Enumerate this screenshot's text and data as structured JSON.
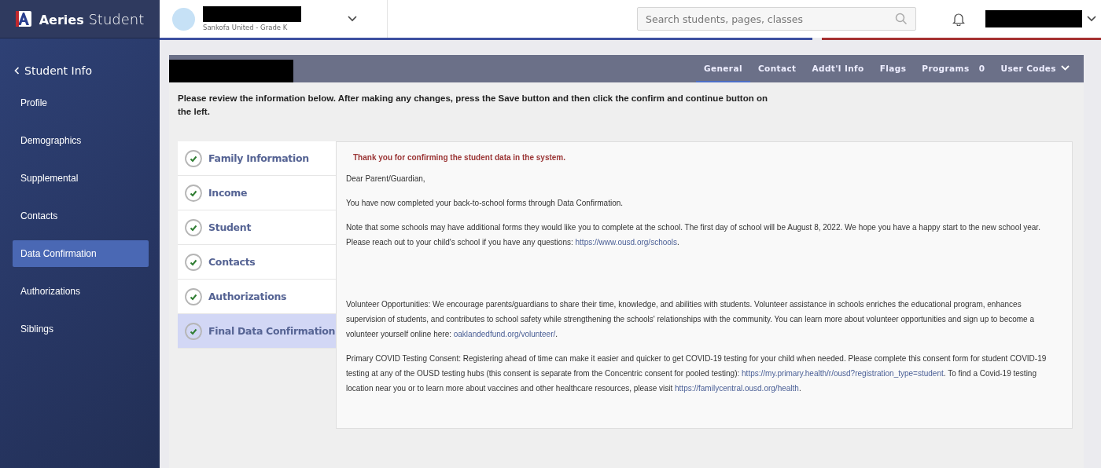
{
  "app": {
    "brand_bold": "Aeries",
    "brand_light": "Student",
    "student_school": "Sankofa United - Grade K",
    "search": {
      "placeholder": "Search students, pages, classes"
    }
  },
  "sidebar": {
    "back": "Student Info",
    "items": [
      {
        "label": "Profile",
        "selected": false
      },
      {
        "label": "Demographics",
        "selected": false
      },
      {
        "label": "Supplemental",
        "selected": false
      },
      {
        "label": "Contacts",
        "selected": false
      },
      {
        "label": "Data Confirmation",
        "selected": true
      },
      {
        "label": "Authorizations",
        "selected": false
      },
      {
        "label": "Siblings",
        "selected": false
      }
    ]
  },
  "tabs": [
    {
      "label": "General",
      "selected": true
    },
    {
      "label": "Contact",
      "selected": false
    },
    {
      "label": "Addt'l Info",
      "selected": false
    },
    {
      "label": "Flags",
      "selected": false
    },
    {
      "label": "Programs",
      "count": "0",
      "selected": false
    },
    {
      "label": "User Codes",
      "dropdown": true,
      "selected": false
    }
  ],
  "instructions": "Please review the information below. After making any changes, press the Save button and then click the confirm and continue button on the left.",
  "steps": [
    {
      "label": "Family Information",
      "completed": true,
      "selected": false
    },
    {
      "label": "Income",
      "completed": true,
      "selected": false
    },
    {
      "label": "Student",
      "completed": true,
      "selected": false
    },
    {
      "label": "Contacts",
      "completed": true,
      "selected": false
    },
    {
      "label": "Authorizations",
      "completed": true,
      "selected": false
    },
    {
      "label": "Final Data Confirmation",
      "completed": true,
      "selected": true
    }
  ],
  "confirmation": {
    "notice": "Thank you for confirming the student data in the system.",
    "paragraphs": [
      {
        "extra_space_after": false,
        "parts": [
          {
            "kind": "text",
            "text": "Dear Parent/Guardian,"
          }
        ]
      },
      {
        "extra_space_after": false,
        "parts": [
          {
            "kind": "text",
            "text": "You have now completed your back-to-school forms through Data Confirmation."
          }
        ]
      },
      {
        "extra_space_after": true,
        "parts": [
          {
            "kind": "text",
            "text": "Note that some schools may have additional forms they would like you to complete at the school. The first day of school will be August 8, 2022. We hope you have a happy start to the new school year. Please reach out to your child's school if you have any questions: "
          },
          {
            "kind": "link",
            "text": "https://www.ousd.org/schools"
          },
          {
            "kind": "text",
            "text": "."
          }
        ]
      },
      {
        "extra_space_after": false,
        "parts": [
          {
            "kind": "text",
            "text": "Volunteer Opportunities: We encourage parents/guardians to share their time, knowledge, and abilities with students. Volunteer assistance in schools enriches the educational program, enhances supervision of students, and contributes to school safety while strengthening the schools' relationships with the community. You can learn more about volunteer opportunities and sign up to become a volunteer yourself online here: "
          },
          {
            "kind": "link",
            "text": "oaklandedfund.org/volunteer/"
          },
          {
            "kind": "text",
            "text": "."
          }
        ]
      },
      {
        "extra_space_after": false,
        "parts": [
          {
            "kind": "text",
            "text": "Primary COVID Testing Consent: Registering ahead of time can make it easier and quicker to get COVID-19 testing for your child when needed. Please complete this consent form for student COVID-19 testing at any of the OUSD testing hubs (this consent is separate from the Concentric consent for pooled testing): "
          },
          {
            "kind": "link",
            "text": "https://my.primary.health/r/ousd?registration_type=student"
          },
          {
            "kind": "text",
            "text": ". To find a Covid-19 testing location near you or to learn more about vaccines and other healthcare resources, please visit "
          },
          {
            "kind": "link",
            "text": "https://familycentral.ousd.org/health"
          },
          {
            "kind": "text",
            "text": "."
          }
        ]
      }
    ]
  }
}
